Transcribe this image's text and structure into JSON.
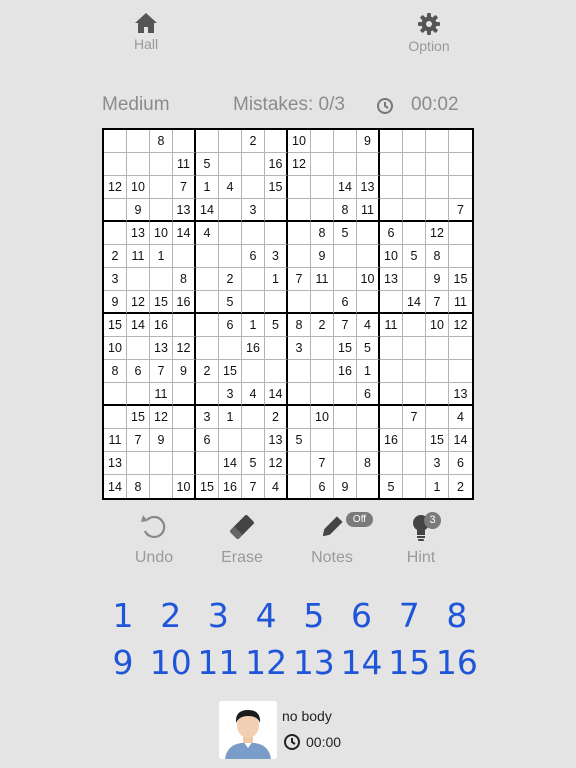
{
  "top_bar": {
    "hall_label": "Hall",
    "option_label": "Option"
  },
  "status": {
    "difficulty": "Medium",
    "mistakes": "Mistakes: 0/3",
    "timer": "00:02"
  },
  "board": {
    "size": 16,
    "rows": [
      [
        "",
        "",
        "8",
        "",
        "",
        "",
        "2",
        "",
        "10",
        "",
        "",
        "9",
        "",
        "",
        "",
        ""
      ],
      [
        "",
        "",
        "",
        "11",
        "5",
        "",
        "",
        "16",
        "12",
        "",
        "",
        "",
        "",
        "",
        "",
        ""
      ],
      [
        "12",
        "10",
        "",
        "7",
        "1",
        "4",
        "",
        "15",
        "",
        "",
        "14",
        "13",
        "",
        "",
        "",
        ""
      ],
      [
        "",
        "9",
        "",
        "13",
        "14",
        "",
        "3",
        "",
        "",
        "",
        "8",
        "11",
        "",
        "",
        "",
        "7"
      ],
      [
        "",
        "13",
        "10",
        "14",
        "4",
        "",
        "",
        "",
        "",
        "8",
        "5",
        "",
        "6",
        "",
        "12",
        ""
      ],
      [
        "2",
        "11",
        "1",
        "",
        "",
        "",
        "6",
        "3",
        "",
        "9",
        "",
        "",
        "10",
        "5",
        "8",
        ""
      ],
      [
        "3",
        "",
        "",
        "8",
        "",
        "2",
        "",
        "1",
        "7",
        "11",
        "",
        "10",
        "13",
        "",
        "9",
        "15"
      ],
      [
        "9",
        "12",
        "15",
        "16",
        "",
        "5",
        "",
        "",
        "",
        "",
        "6",
        "",
        "",
        "14",
        "7",
        "11"
      ],
      [
        "15",
        "14",
        "16",
        "",
        "",
        "6",
        "1",
        "5",
        "8",
        "2",
        "7",
        "4",
        "11",
        "",
        "10",
        "12"
      ],
      [
        "10",
        "",
        "13",
        "12",
        "",
        "",
        "16",
        "",
        "3",
        "",
        "15",
        "5",
        "",
        "",
        "",
        ""
      ],
      [
        "8",
        "6",
        "7",
        "9",
        "2",
        "15",
        "",
        "",
        "",
        "",
        "16",
        "1",
        "",
        "",
        "",
        ""
      ],
      [
        "",
        "",
        "11",
        "",
        "",
        "3",
        "4",
        "14",
        "",
        "",
        "",
        "6",
        "",
        "",
        "",
        "13"
      ],
      [
        "",
        "15",
        "12",
        "",
        "3",
        "1",
        "",
        "2",
        "",
        "10",
        "",
        "",
        "",
        "7",
        "",
        "4"
      ],
      [
        "11",
        "7",
        "9",
        "",
        "6",
        "",
        "",
        "13",
        "5",
        "",
        "",
        "",
        "16",
        "",
        "15",
        "14"
      ],
      [
        "13",
        "",
        "",
        "",
        "",
        "14",
        "5",
        "12",
        "",
        "7",
        "",
        "8",
        "",
        "",
        "3",
        "6"
      ],
      [
        "14",
        "8",
        "",
        "10",
        "15",
        "16",
        "7",
        "4",
        "",
        "6",
        "9",
        "",
        "5",
        "",
        "1",
        "2"
      ]
    ]
  },
  "tools": {
    "undo_label": "Undo",
    "erase_label": "Erase",
    "notes_label": "Notes",
    "notes_state": "Off",
    "hint_label": "Hint",
    "hint_count": "3"
  },
  "numpad": {
    "row1": [
      "1",
      "2",
      "3",
      "4",
      "5",
      "6",
      "7",
      "8"
    ],
    "row2": [
      "9",
      "10",
      "11",
      "12",
      "13",
      "14",
      "15",
      "16"
    ],
    "digit_color": "#1f56d9"
  },
  "player": {
    "name": "no body",
    "time": "00:00"
  }
}
